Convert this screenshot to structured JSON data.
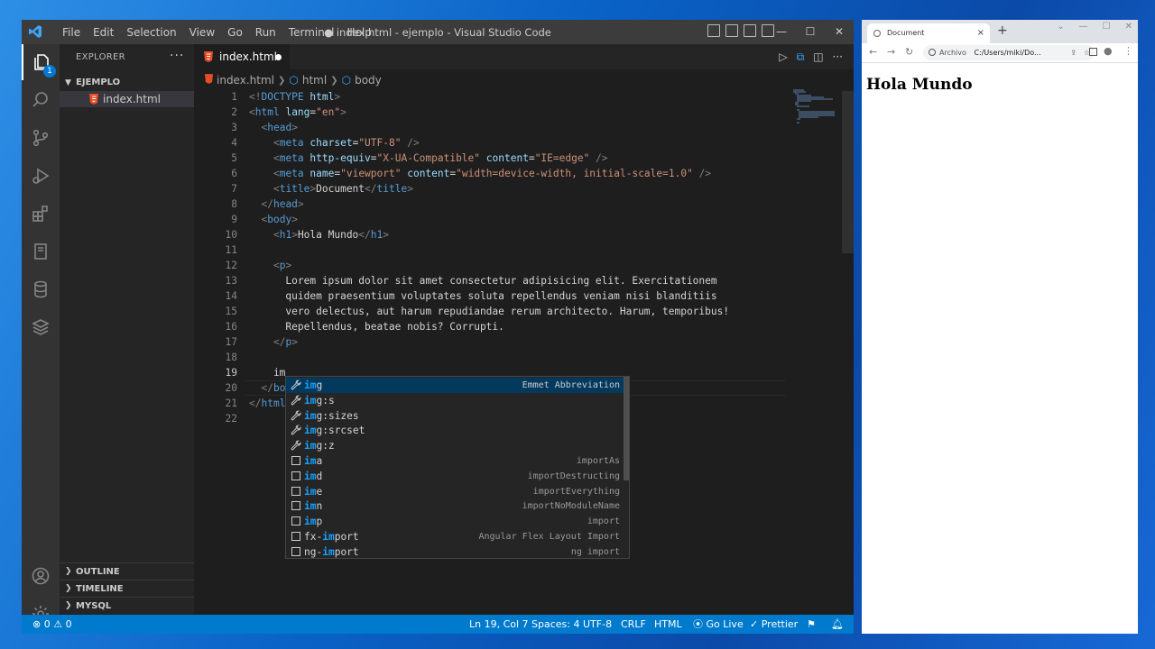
{
  "vscode": {
    "menu": [
      "File",
      "Edit",
      "Selection",
      "View",
      "Go",
      "Run",
      "Terminal",
      "Help"
    ],
    "window_title": "● index.html - ejemplo - Visual Studio Code",
    "window_controls": [
      "—",
      "☐",
      "✕"
    ],
    "activity_badge": "1",
    "explorer": {
      "header": "EXPLORER",
      "more": "···",
      "folder": "EJEMPLO",
      "file": "index.html",
      "sections": [
        "OUTLINE",
        "TIMELINE",
        "MYSQL"
      ]
    },
    "tab": {
      "label": "index.html"
    },
    "breadcrumbs": [
      "index.html",
      "html",
      "body"
    ],
    "current_line": 19,
    "status": {
      "problems": "0",
      "warnings": "0",
      "position": "Ln 19, Col 7",
      "spaces": "Spaces: 4",
      "encoding": "UTF-8",
      "eol": "CRLF",
      "language": "HTML",
      "golive": "Go Live",
      "prettier": "Prettier"
    }
  },
  "code_lines": [
    [
      {
        "c": "p",
        "t": "<!"
      },
      {
        "c": "t",
        "t": "DOCTYPE"
      },
      {
        "c": "tx",
        "t": " "
      },
      {
        "c": "a",
        "t": "html"
      },
      {
        "c": "p",
        "t": ">"
      }
    ],
    [
      {
        "c": "p",
        "t": "<"
      },
      {
        "c": "t",
        "t": "html"
      },
      {
        "c": "tx",
        "t": " "
      },
      {
        "c": "a",
        "t": "lang"
      },
      {
        "c": "tx",
        "t": "="
      },
      {
        "c": "s",
        "t": "\"en\""
      },
      {
        "c": "p",
        "t": ">"
      }
    ],
    [
      {
        "c": "tx",
        "t": "  "
      },
      {
        "c": "p",
        "t": "<"
      },
      {
        "c": "t",
        "t": "head"
      },
      {
        "c": "p",
        "t": ">"
      }
    ],
    [
      {
        "c": "tx",
        "t": "    "
      },
      {
        "c": "p",
        "t": "<"
      },
      {
        "c": "t",
        "t": "meta"
      },
      {
        "c": "tx",
        "t": " "
      },
      {
        "c": "a",
        "t": "charset"
      },
      {
        "c": "tx",
        "t": "="
      },
      {
        "c": "s",
        "t": "\"UTF-8\""
      },
      {
        "c": "tx",
        "t": " "
      },
      {
        "c": "p",
        "t": "/>"
      }
    ],
    [
      {
        "c": "tx",
        "t": "    "
      },
      {
        "c": "p",
        "t": "<"
      },
      {
        "c": "t",
        "t": "meta"
      },
      {
        "c": "tx",
        "t": " "
      },
      {
        "c": "a",
        "t": "http-equiv"
      },
      {
        "c": "tx",
        "t": "="
      },
      {
        "c": "s",
        "t": "\"X-UA-Compatible\""
      },
      {
        "c": "tx",
        "t": " "
      },
      {
        "c": "a",
        "t": "content"
      },
      {
        "c": "tx",
        "t": "="
      },
      {
        "c": "s",
        "t": "\"IE=edge\""
      },
      {
        "c": "tx",
        "t": " "
      },
      {
        "c": "p",
        "t": "/>"
      }
    ],
    [
      {
        "c": "tx",
        "t": "    "
      },
      {
        "c": "p",
        "t": "<"
      },
      {
        "c": "t",
        "t": "meta"
      },
      {
        "c": "tx",
        "t": " "
      },
      {
        "c": "a",
        "t": "name"
      },
      {
        "c": "tx",
        "t": "="
      },
      {
        "c": "s",
        "t": "\"viewport\""
      },
      {
        "c": "tx",
        "t": " "
      },
      {
        "c": "a",
        "t": "content"
      },
      {
        "c": "tx",
        "t": "="
      },
      {
        "c": "s",
        "t": "\"width=device-width, initial-scale=1.0\""
      },
      {
        "c": "tx",
        "t": " "
      },
      {
        "c": "p",
        "t": "/>"
      }
    ],
    [
      {
        "c": "tx",
        "t": "    "
      },
      {
        "c": "p",
        "t": "<"
      },
      {
        "c": "t",
        "t": "title"
      },
      {
        "c": "p",
        "t": ">"
      },
      {
        "c": "tx",
        "t": "Document"
      },
      {
        "c": "p",
        "t": "</"
      },
      {
        "c": "t",
        "t": "title"
      },
      {
        "c": "p",
        "t": ">"
      }
    ],
    [
      {
        "c": "tx",
        "t": "  "
      },
      {
        "c": "p",
        "t": "</"
      },
      {
        "c": "t",
        "t": "head"
      },
      {
        "c": "p",
        "t": ">"
      }
    ],
    [
      {
        "c": "tx",
        "t": "  "
      },
      {
        "c": "p",
        "t": "<"
      },
      {
        "c": "t",
        "t": "body"
      },
      {
        "c": "p",
        "t": ">"
      }
    ],
    [
      {
        "c": "tx",
        "t": "    "
      },
      {
        "c": "p",
        "t": "<"
      },
      {
        "c": "t",
        "t": "h1"
      },
      {
        "c": "p",
        "t": ">"
      },
      {
        "c": "tx",
        "t": "Hola Mundo"
      },
      {
        "c": "p",
        "t": "</"
      },
      {
        "c": "t",
        "t": "h1"
      },
      {
        "c": "p",
        "t": ">"
      }
    ],
    [],
    [
      {
        "c": "tx",
        "t": "    "
      },
      {
        "c": "p",
        "t": "<"
      },
      {
        "c": "t",
        "t": "p"
      },
      {
        "c": "p",
        "t": ">"
      }
    ],
    [
      {
        "c": "tx",
        "t": "      Lorem ipsum dolor sit amet consectetur adipisicing elit. Exercitationem"
      }
    ],
    [
      {
        "c": "tx",
        "t": "      quidem praesentium voluptates soluta repellendus veniam nisi blanditiis"
      }
    ],
    [
      {
        "c": "tx",
        "t": "      vero delectus, aut harum repudiandae rerum architecto. Harum, temporibus!"
      }
    ],
    [
      {
        "c": "tx",
        "t": "      Repellendus, beatae nobis? Corrupti."
      }
    ],
    [
      {
        "c": "tx",
        "t": "    "
      },
      {
        "c": "p",
        "t": "</"
      },
      {
        "c": "t",
        "t": "p"
      },
      {
        "c": "p",
        "t": ">"
      }
    ],
    [],
    [
      {
        "c": "tx",
        "t": "    im"
      }
    ],
    [
      {
        "c": "tx",
        "t": "  "
      },
      {
        "c": "p",
        "t": "</"
      },
      {
        "c": "t",
        "t": "bo"
      }
    ],
    [
      {
        "c": "p",
        "t": "</"
      },
      {
        "c": "t",
        "t": "html"
      }
    ],
    []
  ],
  "suggestions": [
    {
      "pre": "",
      "match": "im",
      "post": "g",
      "detail": "Emmet Abbreviation",
      "icon": "wrench-icon",
      "selected": true
    },
    {
      "pre": "",
      "match": "im",
      "post": "g:s",
      "detail": "",
      "icon": "wrench-icon"
    },
    {
      "pre": "",
      "match": "im",
      "post": "g:sizes",
      "detail": "",
      "icon": "wrench-icon"
    },
    {
      "pre": "",
      "match": "im",
      "post": "g:srcset",
      "detail": "",
      "icon": "wrench-icon"
    },
    {
      "pre": "",
      "match": "im",
      "post": "g:z",
      "detail": "",
      "icon": "wrench-icon"
    },
    {
      "pre": "",
      "match": "im",
      "post": "a",
      "detail": "importAs",
      "icon": "snippet-icon"
    },
    {
      "pre": "",
      "match": "im",
      "post": "d",
      "detail": "importDestructing",
      "icon": "snippet-icon"
    },
    {
      "pre": "",
      "match": "im",
      "post": "e",
      "detail": "importEverything",
      "icon": "snippet-icon"
    },
    {
      "pre": "",
      "match": "im",
      "post": "n",
      "detail": "importNoModuleName",
      "icon": "snippet-icon"
    },
    {
      "pre": "",
      "match": "im",
      "post": "p",
      "detail": "import",
      "icon": "snippet-icon"
    },
    {
      "pre": "fx-",
      "match": "im",
      "post": "port",
      "detail": "Angular Flex Layout Import",
      "icon": "snippet-icon"
    },
    {
      "pre": "ng-",
      "match": "im",
      "post": "port",
      "detail": "ng import",
      "icon": "snippet-icon"
    }
  ],
  "browser": {
    "tab_title": "Document",
    "tab_close": "×",
    "new_tab": "+",
    "url_label": "Archivo",
    "url_path": "C:/Users/miki/Do...",
    "heading": "Hola Mundo"
  },
  "colors": {
    "accent": "#007acc",
    "editor_bg": "#1e1e1e",
    "tag": "#569cd6",
    "attr": "#9cdcfe",
    "string": "#ce9178",
    "match": "#18a3ff"
  }
}
